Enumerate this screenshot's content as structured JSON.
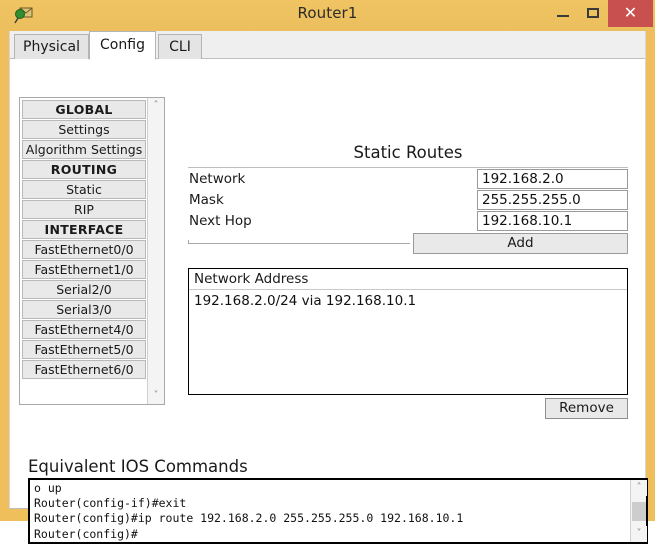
{
  "window": {
    "title": "Router1",
    "icon": "router-device-icon",
    "controls": {
      "minimize": "–",
      "maximize": "□",
      "close": "✕"
    },
    "colors": {
      "titlebar": "#efbf5c",
      "close_button": "#c8504f",
      "tab_active_bg": "#ffffff",
      "tab_inactive_bg": "#e4e4e4"
    }
  },
  "tabs": [
    {
      "label": "Physical",
      "active": false
    },
    {
      "label": "Config",
      "active": true
    },
    {
      "label": "CLI",
      "active": false
    }
  ],
  "sidebar": {
    "items": [
      {
        "label": "GLOBAL",
        "type": "header"
      },
      {
        "label": "Settings",
        "type": "item"
      },
      {
        "label": "Algorithm Settings",
        "type": "item"
      },
      {
        "label": "ROUTING",
        "type": "header"
      },
      {
        "label": "Static",
        "type": "item"
      },
      {
        "label": "RIP",
        "type": "item"
      },
      {
        "label": "INTERFACE",
        "type": "header"
      },
      {
        "label": "FastEthernet0/0",
        "type": "item"
      },
      {
        "label": "FastEthernet1/0",
        "type": "item"
      },
      {
        "label": "Serial2/0",
        "type": "item"
      },
      {
        "label": "Serial3/0",
        "type": "item"
      },
      {
        "label": "FastEthernet4/0",
        "type": "item"
      },
      {
        "label": "FastEthernet5/0",
        "type": "item"
      },
      {
        "label": "FastEthernet6/0",
        "type": "item"
      }
    ],
    "scroll_up_icon": "˄",
    "scroll_down_icon": "˅"
  },
  "static_routes": {
    "title": "Static Routes",
    "fields": [
      {
        "label": "Network",
        "value": "192.168.2.0"
      },
      {
        "label": "Mask",
        "value": "255.255.255.0"
      },
      {
        "label": "Next Hop",
        "value": "192.168.10.1"
      }
    ],
    "add_button": "Add",
    "remove_button": "Remove",
    "list_header": "Network Address",
    "list_rows": [
      "192.168.2.0/24 via 192.168.10.1"
    ]
  },
  "ios": {
    "title": "Equivalent IOS Commands",
    "lines": "o up\nRouter(config-if)#exit\nRouter(config)#ip route 192.168.2.0 255.255.255.0 192.168.10.1\nRouter(config)#",
    "scroll_up_icon": "˄",
    "scroll_down_icon": "˅"
  }
}
